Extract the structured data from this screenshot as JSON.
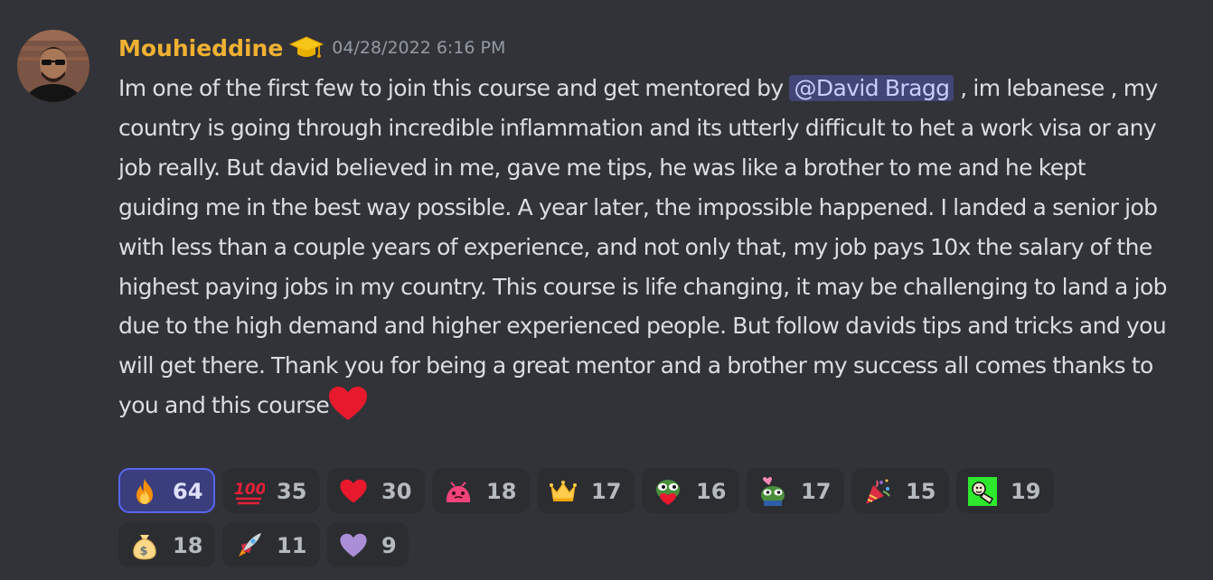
{
  "message": {
    "author": "Mouhieddine",
    "author_color": "#f0b132",
    "role_icon": "graduation-cap-icon",
    "timestamp": "04/28/2022 6:16 PM",
    "text_before_mention": "Im one of the first few to join this course and get mentored by ",
    "mention": "@David Bragg",
    "text_after_mention": " , im lebanese , my country is going through incredible inflammation and its utterly difficult to het a work visa or any job really. But david believed in me, gave me tips, he was like a brother to me and he kept guiding me in the best way possible. A year later, the impossible happened. I landed a senior job with less than a couple years of experience, and not only that, my job pays 10x the salary of the highest paying jobs in my country. This course is life changing, it may be challenging to land a job due to the high demand and higher experienced people. But follow davids tips and tricks and you will get there. Thank you for being a great mentor and a brother my success all comes thanks to you and this course",
    "trailing_emoji": "red-heart-icon"
  },
  "reactions": [
    {
      "emoji": "fire-icon",
      "count": "64",
      "active": true
    },
    {
      "emoji": "hundred-points-icon",
      "count": "35",
      "active": false
    },
    {
      "emoji": "red-heart-icon",
      "count": "30",
      "active": false
    },
    {
      "emoji": "pink-blob-icon",
      "count": "18",
      "active": false
    },
    {
      "emoji": "crown-icon",
      "count": "17",
      "active": false
    },
    {
      "emoji": "pepe-heart-icon",
      "count": "16",
      "active": false
    },
    {
      "emoji": "pepe-love-icon",
      "count": "17",
      "active": false
    },
    {
      "emoji": "party-popper-icon",
      "count": "15",
      "active": false
    },
    {
      "emoji": "green-face-icon",
      "count": "19",
      "active": false
    },
    {
      "emoji": "money-bag-icon",
      "count": "18",
      "active": false
    },
    {
      "emoji": "rocket-icon",
      "count": "11",
      "active": false
    },
    {
      "emoji": "purple-heart-icon",
      "count": "9",
      "active": false
    }
  ],
  "colors": {
    "background": "#313338",
    "mention_bg": "#414676",
    "reaction_active_border": "#5865f2"
  }
}
